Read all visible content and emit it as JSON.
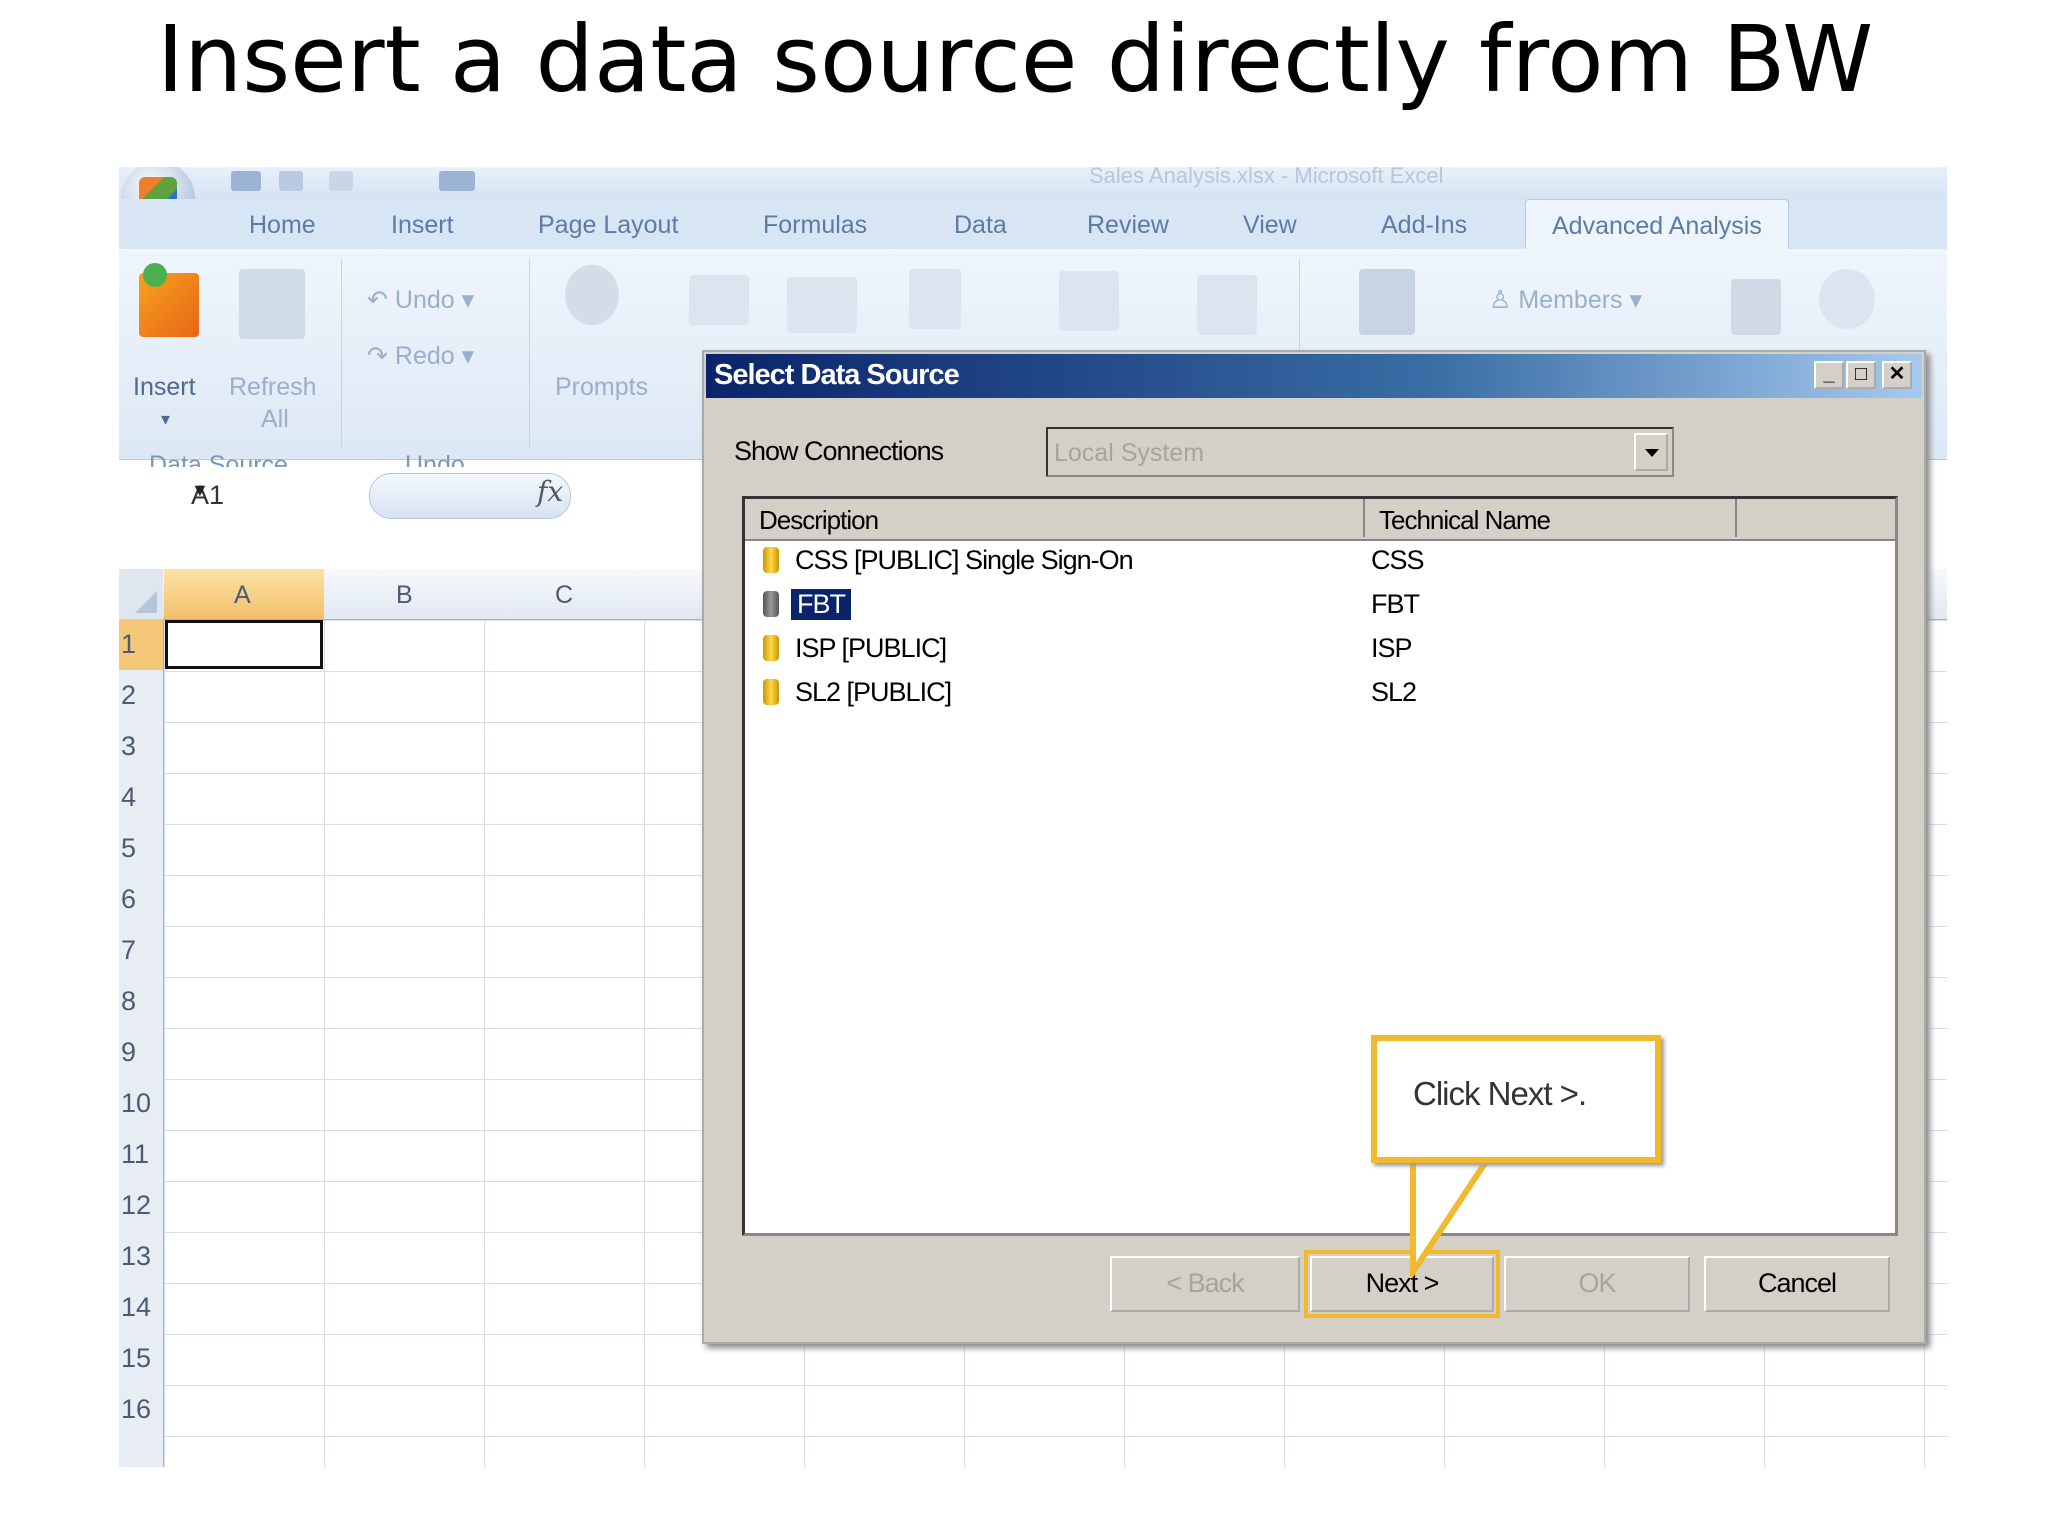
{
  "slide": {
    "title": "Insert a data source directly from BW"
  },
  "window": {
    "title": "Sales Analysis.xlsx - Microsoft Excel"
  },
  "ribbon": {
    "tabs": [
      "Home",
      "Insert",
      "Page Layout",
      "Formulas",
      "Data",
      "Review",
      "View",
      "Add-Ins",
      "Advanced Analysis"
    ],
    "active_tab": "Advanced Analysis",
    "insert_label": "Insert",
    "refresh_label": "Refresh",
    "refresh_all_label": "All",
    "undo_label": "Undo",
    "redo_label": "Redo",
    "prompts_label": "Prompts",
    "members_label": "Members",
    "group_data_source": "Data Source",
    "group_undo": "Undo"
  },
  "formula_bar": {
    "cell_ref": "A1",
    "fx_label": "fx"
  },
  "sheet": {
    "columns": [
      "A",
      "B",
      "C"
    ],
    "rows": [
      "1",
      "2",
      "3",
      "4",
      "5",
      "6",
      "7",
      "8",
      "9",
      "10",
      "11",
      "12",
      "13",
      "14",
      "15",
      "16"
    ]
  },
  "dialog": {
    "title": "Select Data Source",
    "show_connections_label": "Show Connections",
    "connection_value": "Local System",
    "columns": {
      "description": "Description",
      "technical_name": "Technical Name"
    },
    "rows": [
      {
        "description": "CSS [PUBLIC] Single Sign-On",
        "technical": "CSS",
        "selected": false
      },
      {
        "description": "FBT",
        "technical": "FBT",
        "selected": true
      },
      {
        "description": "ISP [PUBLIC]",
        "technical": "ISP",
        "selected": false
      },
      {
        "description": "SL2 [PUBLIC]",
        "technical": "SL2",
        "selected": false
      }
    ],
    "buttons": {
      "back": "< Back",
      "next": "Next >",
      "ok": "OK",
      "cancel": "Cancel"
    }
  },
  "callout": {
    "text": "Click Next >."
  },
  "colors": {
    "highlight": "#f1b92b",
    "titlebar": "#0a246a",
    "selection": "#0a246a"
  }
}
